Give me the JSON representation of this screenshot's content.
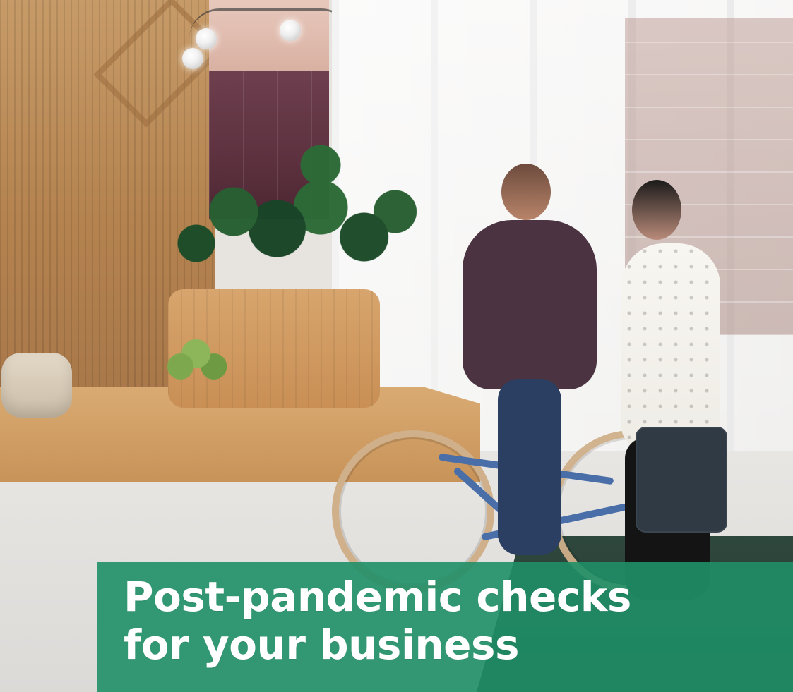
{
  "caption": {
    "line1": "Post-pandemic checks",
    "line2": "for your business",
    "bg_color": "#1F8F67",
    "text_color": "#FFFFFF"
  }
}
